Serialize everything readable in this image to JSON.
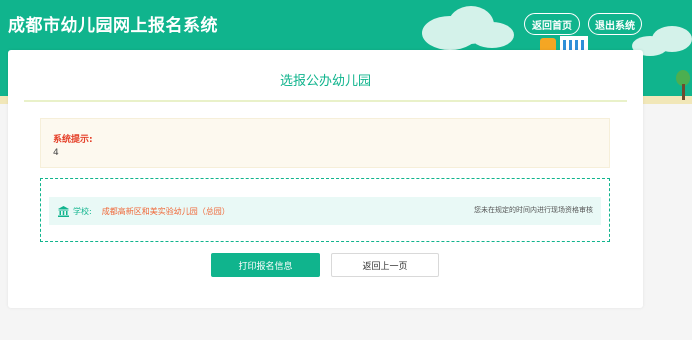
{
  "header": {
    "site_title": "成都市幼儿园网上报名系统",
    "home_button": "返回首页",
    "logout_button": "退出系统"
  },
  "card": {
    "title": "选报公办幼儿园",
    "notice": {
      "label": "系统提示:",
      "value": "4"
    },
    "school": {
      "label": "学校:",
      "name": "成都高新区和美实验幼儿园（总园）",
      "status": "您未在规定的时间内进行现场资格审核"
    },
    "print_button": "打印报名信息",
    "back_button": "返回上一页"
  },
  "colors": {
    "accent": "#10b48d",
    "notice_label": "#e5412a",
    "school_name": "#f0693a"
  },
  "icons": {
    "school": "school-building-icon"
  }
}
